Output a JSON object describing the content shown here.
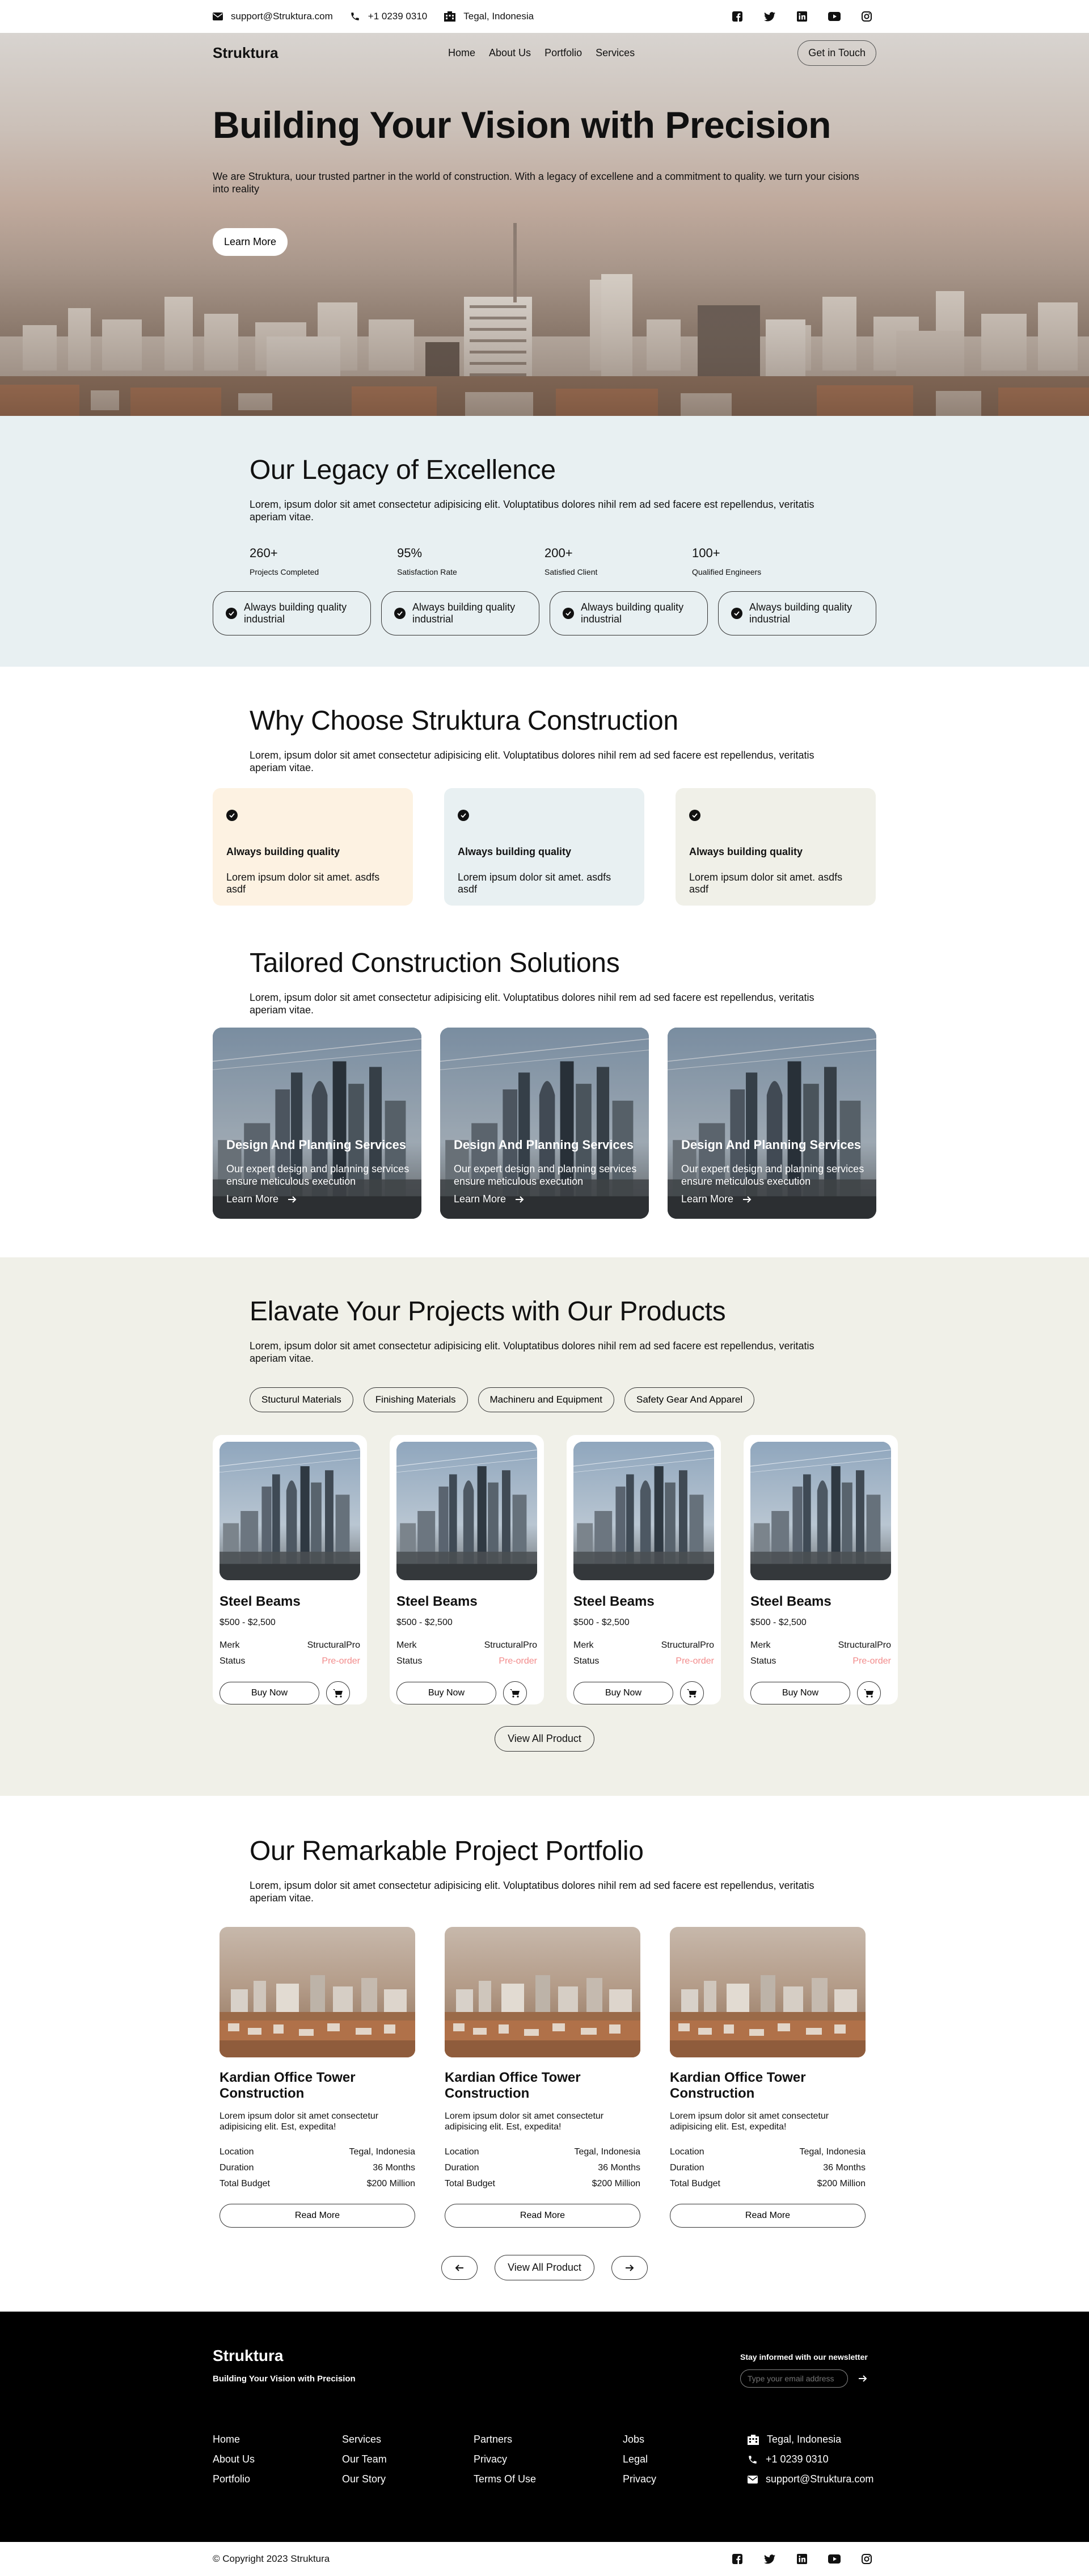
{
  "topbar": {
    "email": "support@Struktura.com",
    "phone": "+1 0239 0310",
    "location": "Tegal, Indonesia",
    "social_icons": [
      "facebook-icon",
      "twitter-icon",
      "linkedin-icon",
      "youtube-icon",
      "instagram-icon"
    ]
  },
  "nav": {
    "brand": "Struktura",
    "links": [
      "Home",
      "About Us",
      "Portfolio",
      "Services"
    ],
    "cta": "Get in Touch"
  },
  "hero": {
    "title": "Building Your Vision with Precision",
    "subtitle": "We are Struktura, uour trusted partner in the world of construction. With a legacy of excellene and a commitment to quality. we turn your cisions into reality",
    "button": "Learn More"
  },
  "legacy": {
    "title": "Our Legacy of Excellence",
    "lead": "Lorem, ipsum dolor sit amet consectetur adipisicing elit. Voluptatibus dolores nihil rem ad sed facere est repellendus, veritatis aperiam vitae.",
    "stats": [
      {
        "value": "260+",
        "label": "Projects Completed"
      },
      {
        "value": "95%",
        "label": "Satisfaction Rate"
      },
      {
        "value": "200+",
        "label": "Satisfied Client"
      },
      {
        "value": "100+",
        "label": "Qualified Engineers"
      }
    ],
    "pills": [
      "Always building quality industrial",
      "Always building quality industrial",
      "Always building quality industrial",
      "Always building quality industrial"
    ]
  },
  "why": {
    "title": "Why Choose Struktura Construction",
    "lead": "Lorem, ipsum dolor sit amet consectetur adipisicing elit. Voluptatibus dolores nihil rem ad sed facere est repellendus, veritatis aperiam vitae.",
    "cards": [
      {
        "title": "Always building quality",
        "text": "Lorem ipsum dolor sit amet. asdfs asdf",
        "bg": "#fdf2e2"
      },
      {
        "title": "Always building quality",
        "text": "Lorem ipsum dolor sit amet. asdfs asdf",
        "bg": "#e8f0f2"
      },
      {
        "title": "Always building quality",
        "text": "Lorem ipsum dolor sit amet. asdfs asdf",
        "bg": "#f0f0e8"
      }
    ]
  },
  "tailored": {
    "title": "Tailored Construction Solutions",
    "lead": "Lorem, ipsum dolor sit amet consectetur adipisicing elit. Voluptatibus dolores nihil rem ad sed facere est repellendus, veritatis aperiam vitae.",
    "cards": [
      {
        "title": "Design And Planning Services",
        "text": "Our expert design and planning services ensure meticulous execution",
        "link": "Learn More"
      },
      {
        "title": "Design And Planning Services",
        "text": "Our expert design and planning services ensure meticulous execution",
        "link": "Learn More"
      },
      {
        "title": "Design And Planning Services",
        "text": "Our expert design and planning services ensure meticulous execution",
        "link": "Learn More"
      }
    ]
  },
  "products": {
    "title": "Elavate Your Projects with Our Products",
    "lead": "Lorem, ipsum dolor sit amet consectetur adipisicing elit. Voluptatibus dolores nihil rem ad sed facere est repellendus, veritatis aperiam vitae.",
    "tabs": [
      "Stucturul Materials",
      "Finishing Materials",
      "Machineru and Equipment",
      "Safety Gear And Apparel"
    ],
    "items": [
      {
        "name": "Steel Beams",
        "price": "$500 - $2,500",
        "merk_label": "Merk",
        "merk": "StructuralPro",
        "status_label": "Status",
        "status": "Pre-order",
        "buy": "Buy Now"
      },
      {
        "name": "Steel Beams",
        "price": "$500 - $2,500",
        "merk_label": "Merk",
        "merk": "StructuralPro",
        "status_label": "Status",
        "status": "Pre-order",
        "buy": "Buy Now"
      },
      {
        "name": "Steel Beams",
        "price": "$500 - $2,500",
        "merk_label": "Merk",
        "merk": "StructuralPro",
        "status_label": "Status",
        "status": "Pre-order",
        "buy": "Buy Now"
      },
      {
        "name": "Steel Beams",
        "price": "$500 - $2,500",
        "merk_label": "Merk",
        "merk": "StructuralPro",
        "status_label": "Status",
        "status": "Pre-order",
        "buy": "Buy Now"
      }
    ],
    "view_all": "View All Product"
  },
  "portfolio": {
    "title": "Our Remarkable Project Portfolio",
    "lead": "Lorem, ipsum dolor sit amet consectetur adipisicing elit. Voluptatibus dolores nihil rem ad sed facere est repellendus, veritatis aperiam vitae.",
    "items": [
      {
        "title": "Kardian Office Tower Construction",
        "text": "Lorem ipsum dolor sit amet consectetur adipisicing elit. Est, expedita!",
        "location_label": "Location",
        "location": "Tegal, Indonesia",
        "duration_label": "Duration",
        "duration": "36 Months",
        "budget_label": "Total Budget",
        "budget": "$200 Million",
        "button": "Read More"
      },
      {
        "title": "Kardian Office Tower Construction",
        "text": "Lorem ipsum dolor sit amet consectetur adipisicing elit. Est, expedita!",
        "location_label": "Location",
        "location": "Tegal, Indonesia",
        "duration_label": "Duration",
        "duration": "36 Months",
        "budget_label": "Total Budget",
        "budget": "$200 Million",
        "button": "Read More"
      },
      {
        "title": "Kardian Office Tower Construction",
        "text": "Lorem ipsum dolor sit amet consectetur adipisicing elit. Est, expedita!",
        "location_label": "Location",
        "location": "Tegal, Indonesia",
        "duration_label": "Duration",
        "duration": "36 Months",
        "budget_label": "Total Budget",
        "budget": "$200 Million",
        "button": "Read More"
      }
    ],
    "view_all": "View All Product"
  },
  "footer": {
    "brand": "Struktura",
    "tagline": "Building Your Vision with Precision",
    "newsletter_title": "Stay informed with our newsletter",
    "newsletter_placeholder": "Type your email address",
    "col1": [
      "Home",
      "About Us",
      "Portfolio"
    ],
    "col2": [
      "Services",
      "Our Team",
      "Our Story"
    ],
    "col3": [
      "Partners",
      "Privacy",
      "Terms Of Use"
    ],
    "col4": [
      "Jobs",
      "Legal",
      "Privacy"
    ],
    "contact": {
      "location": "Tegal, Indonesia",
      "phone": "+1 0239 0310",
      "email": "support@Struktura.com"
    }
  },
  "bottom": {
    "copyright": "© Copyright 2023 Struktura"
  }
}
